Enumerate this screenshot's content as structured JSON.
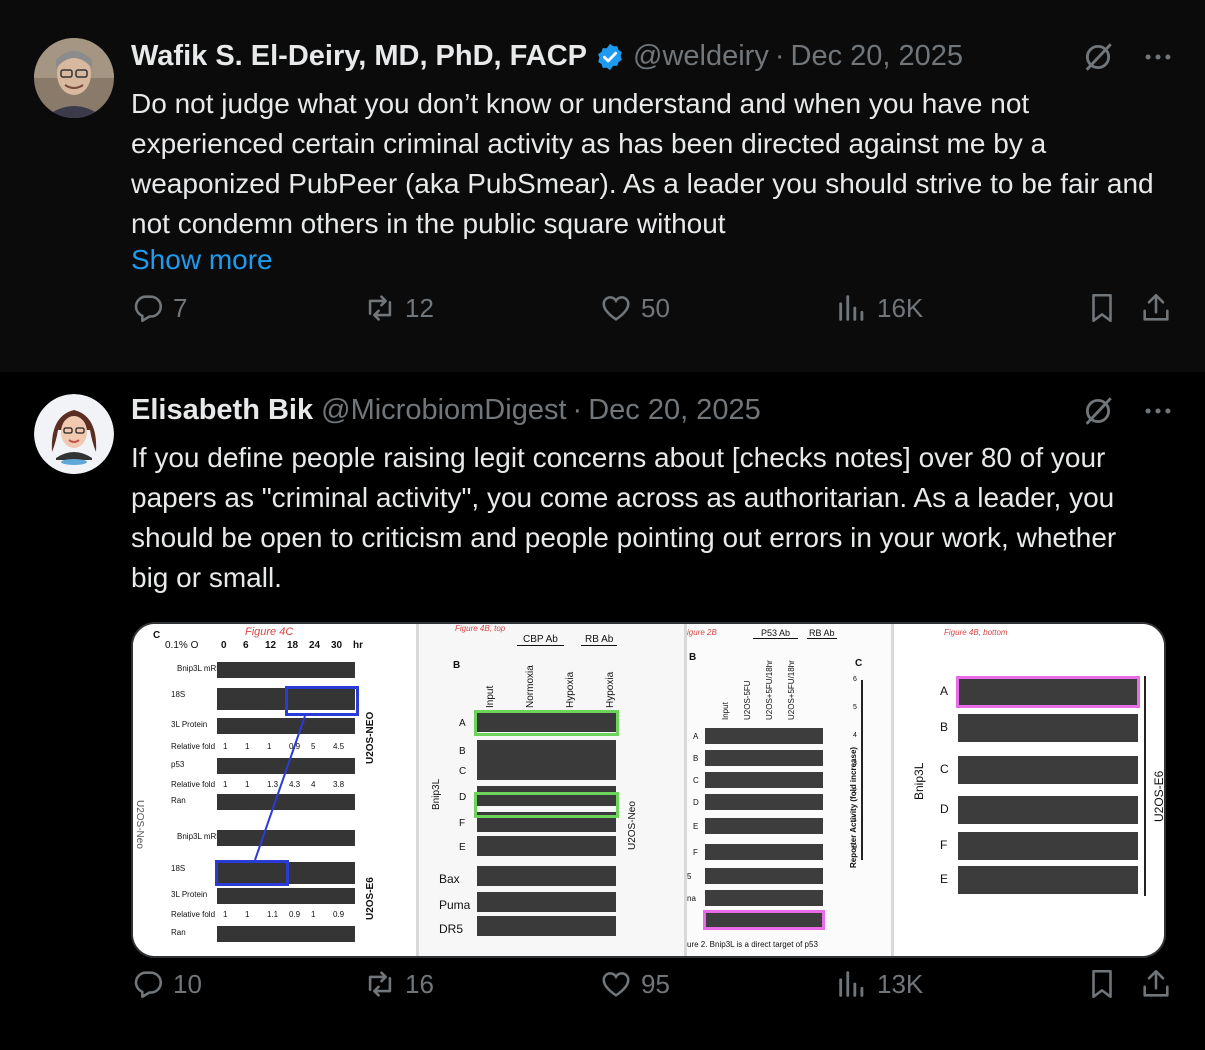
{
  "tweets": [
    {
      "author": "Wafik S. El-Deiry, MD, PhD, FACP",
      "verified": true,
      "handle": "@weldeiry",
      "separator": "·",
      "date": "Dec 20, 2025",
      "text": "Do not judge what you don’t know or understand and when you have not experienced certain criminal activity as has been directed against me by a weaponized PubPeer (aka PubSmear). As a leader you should strive to be fair and not condemn others in the public square without",
      "show_more": "Show more",
      "replies": "7",
      "reposts": "12",
      "likes": "50",
      "views": "16K"
    },
    {
      "author": "Elisabeth Bik",
      "verified": false,
      "handle": "@MicrobiomDigest",
      "separator": "·",
      "date": "Dec 20, 2025",
      "text": "If you define people raising legit concerns about [checks notes] over 80 of your papers as \"criminal activity\", you come across as authoritarian. As a leader, you should be open to criticism and people pointing out errors in your work, whether big or small.",
      "replies": "10",
      "reposts": "16",
      "likes": "95",
      "views": "13K"
    }
  ],
  "media": {
    "panel1": {
      "figure_label": "Figure 4C",
      "corner_letter": "C",
      "condition": "0.1% O",
      "timepoints": [
        "0",
        "6",
        "12",
        "18",
        "24",
        "30",
        "hr"
      ],
      "rows": [
        "Bnip3L mRNA",
        "18S",
        "3L Protein",
        "Relative fold",
        "p53",
        "Relative fold",
        "Ran",
        "Bnip3L mRNA",
        "18S",
        "3L Protein",
        "Relative fold",
        "Ran"
      ],
      "rel_fold_1": [
        "1",
        "1",
        "1",
        "0.9",
        "5",
        "4.5"
      ],
      "rel_fold_2": [
        "1",
        "1",
        "1.3",
        "4.3",
        "4",
        "3.8"
      ],
      "rel_fold_3": [
        "1",
        "1",
        "1.1",
        "0.9",
        "1",
        "0.9"
      ],
      "side_labels": [
        "U2OS-NEO",
        "U2OS-E6",
        "U2OS-Neo"
      ]
    },
    "panel2": {
      "figure_label": "Figure 4B, top",
      "corner_letter": "B",
      "groups": [
        "CBP Ab",
        "RB Ab"
      ],
      "columns": [
        "Input",
        "Normoxia",
        "Hypoxia",
        "Hypoxia"
      ],
      "rows": [
        "A",
        "B",
        "C",
        "D",
        "F",
        "E",
        "Bax",
        "Puma",
        "DR5"
      ],
      "row_group": "Bnip3L",
      "side_label": "U2OS-Neo"
    },
    "panel3": {
      "figure_label": "igure 2B",
      "corner_letter": "B",
      "groups": [
        "P53 Ab",
        "RB Ab"
      ],
      "columns": [
        "Input",
        "U2OS-5FU",
        "U2OS+5FU/18hr",
        "U2OS+5FU/18hr"
      ],
      "rows": [
        "A",
        "B",
        "C",
        "D",
        "E",
        "F",
        "5",
        "na"
      ],
      "y_axis": "Reporter Activity (fold increase)",
      "y_ticks": [
        "6",
        "5",
        "4",
        "3",
        "2",
        "1",
        "0"
      ],
      "c_letter": "C",
      "caption": "ure 2. Bnip3L is a direct target of p53"
    },
    "panel4": {
      "figure_label": "Figure 4B, bottom",
      "rows": [
        "A",
        "B",
        "C",
        "D",
        "F",
        "E"
      ],
      "row_group": "Bnip3L",
      "side_label": "U2OS-E6"
    }
  }
}
